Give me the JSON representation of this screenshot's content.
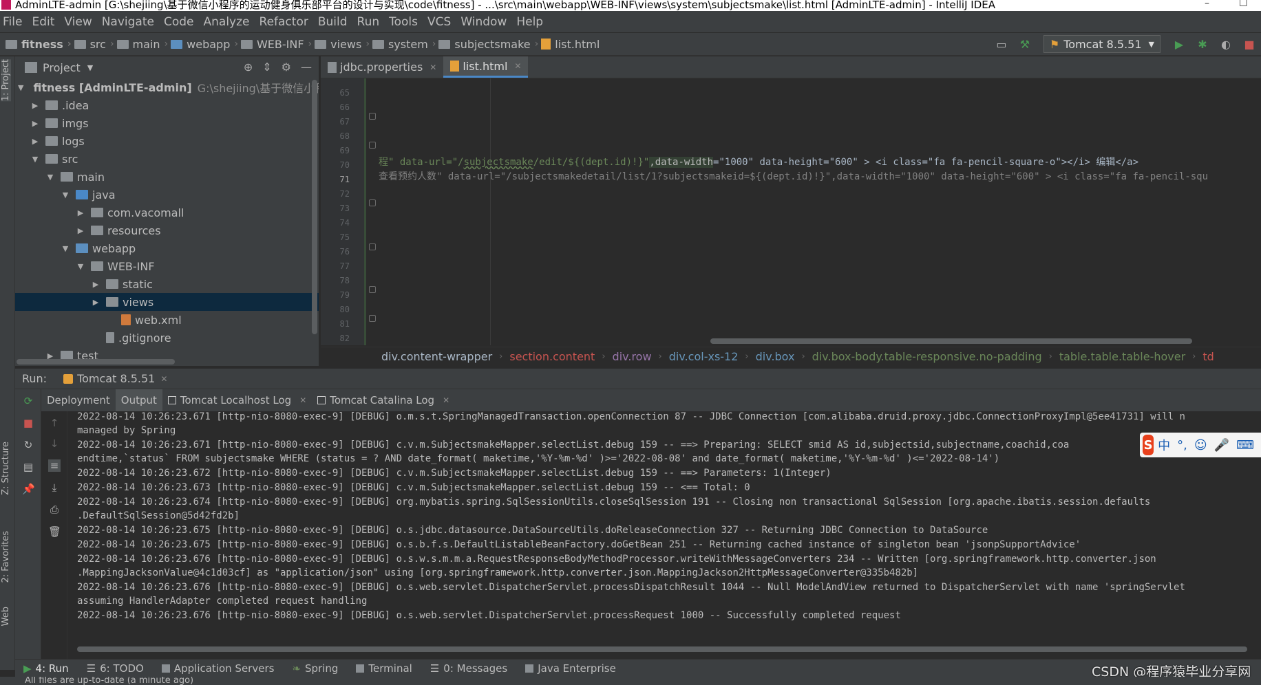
{
  "window": {
    "title": "AdminLTE-admin [G:\\shejiing\\基于微信小程序的运动健身俱乐部平台的设计与实现\\code\\fitness] - ...\\src\\main\\webapp\\WEB-INF\\views\\system\\subjectsmake\\list.html [AdminLTE-admin] - IntelliJ IDEA",
    "minimize": "–",
    "maximize": "☐"
  },
  "menu": [
    "File",
    "Edit",
    "View",
    "Navigate",
    "Code",
    "Analyze",
    "Refactor",
    "Build",
    "Run",
    "Tools",
    "VCS",
    "Window",
    "Help"
  ],
  "nav": {
    "crumbs": [
      "fitness",
      "src",
      "main",
      "webapp",
      "WEB-INF",
      "views",
      "system",
      "subjectsmake"
    ],
    "file": "list.html",
    "run_config": "Tomcat 8.5.51"
  },
  "project": {
    "header": "Project",
    "root_name": "fitness [AdminLTE-admin]",
    "root_path": "G:\\shejiing\\基于微信小程序",
    "items": [
      {
        "label": ".idea",
        "expanded": false
      },
      {
        "label": "imgs",
        "expanded": false
      },
      {
        "label": "logs",
        "expanded": false
      },
      {
        "label": "src",
        "expanded": true
      },
      {
        "label": "main",
        "expanded": true
      },
      {
        "label": "java",
        "expanded": true
      },
      {
        "label": "com.vacomall",
        "expanded": false
      },
      {
        "label": "resources",
        "expanded": false
      },
      {
        "label": "webapp",
        "expanded": true
      },
      {
        "label": "WEB-INF",
        "expanded": true
      },
      {
        "label": "static",
        "expanded": false
      },
      {
        "label": "views",
        "expanded": false
      },
      {
        "label": "web.xml",
        "expanded": null
      },
      {
        "label": ".gitignore",
        "expanded": null
      },
      {
        "label": "test",
        "expanded": false
      }
    ]
  },
  "editor": {
    "tabs": [
      "jdbc.properties",
      "list.html"
    ],
    "line_numbers": [
      "65",
      "66",
      "67",
      "68",
      "69",
      "70",
      "71",
      "72",
      "73",
      "74",
      "75",
      "76",
      "77",
      "78",
      "79",
      "80",
      "81",
      "82"
    ],
    "line70": {
      "p1": "程\" data-url=\"/",
      "p2": "subjectsmake",
      "p3": "/edit/${(dept.id)!}\"",
      "p4": ",data-width",
      "p5": "=\"1000\" data-height=\"600\" > <i class=\"fa fa-pencil-square-o\"></i> 编辑</a>"
    },
    "line71": "查看预约人数\" data-url=\"/subjectsmakedetail/list/1?subjectsmakeid=${(dept.id)!}\",data-width=\"1000\" data-height=\"600\" > <i class=\"fa fa-pencil-squ",
    "breadcrumbs": [
      "div.content-wrapper",
      "section.content",
      "div.row",
      "div.col-xs-12",
      "div.box",
      "div.box-body.table-responsive.no-padding",
      "table.table.table-hover",
      "td"
    ]
  },
  "run": {
    "label": "Run:",
    "config_tab": "Tomcat 8.5.51",
    "subtabs": [
      "Deployment",
      "Output",
      "Tomcat Localhost Log",
      "Tomcat Catalina Log"
    ],
    "console": [
      "2022-08-14 10:26:23.671 [http-nio-8080-exec-9] [DEBUG] o.m.s.t.SpringManagedTransaction.openConnection 87 -- JDBC Connection [com.alibaba.druid.proxy.jdbc.ConnectionProxyImpl@5ee41731] will n",
      " managed by Spring",
      "2022-08-14 10:26:23.671 [http-nio-8080-exec-9] [DEBUG] c.v.m.SubjectsmakeMapper.selectList.debug 159 -- ==>  Preparing: SELECT smid AS id,subjectsid,subjectname,coachid,coa",
      " endtime,`status` FROM subjectsmake WHERE (status = ? AND date_format( maketime,'%Y-%m-%d' )>='2022-08-08' and date_format( maketime,'%Y-%m-%d' )<='2022-08-14')",
      "2022-08-14 10:26:23.672 [http-nio-8080-exec-9] [DEBUG] c.v.m.SubjectsmakeMapper.selectList.debug 159 -- ==> Parameters: 1(Integer)",
      "2022-08-14 10:26:23.673 [http-nio-8080-exec-9] [DEBUG] c.v.m.SubjectsmakeMapper.selectList.debug 159 -- <==      Total: 0",
      "2022-08-14 10:26:23.674 [http-nio-8080-exec-9] [DEBUG] org.mybatis.spring.SqlSessionUtils.closeSqlSession 191 -- Closing non transactional SqlSession [org.apache.ibatis.session.defaults",
      " .DefaultSqlSession@5d42fd2b]",
      "2022-08-14 10:26:23.675 [http-nio-8080-exec-9] [DEBUG] o.s.jdbc.datasource.DataSourceUtils.doReleaseConnection 327 -- Returning JDBC Connection to DataSource",
      "2022-08-14 10:26:23.675 [http-nio-8080-exec-9] [DEBUG] o.s.b.f.s.DefaultListableBeanFactory.doGetBean 251 -- Returning cached instance of singleton bean 'jsonpSupportAdvice'",
      "2022-08-14 10:26:23.676 [http-nio-8080-exec-9] [DEBUG] o.s.w.s.m.m.a.RequestResponseBodyMethodProcessor.writeWithMessageConverters 234 -- Written [org.springframework.http.converter.json",
      " .MappingJacksonValue@4c1d03cf] as \"application/json\" using [org.springframework.http.converter.json.MappingJackson2HttpMessageConverter@335b482b]",
      "2022-08-14 10:26:23.676 [http-nio-8080-exec-9] [DEBUG] o.s.web.servlet.DispatcherServlet.processDispatchResult 1044 -- Null ModelAndView returned to DispatcherServlet with name 'springServlet",
      " assuming HandlerAdapter completed request handling",
      "2022-08-14 10:26:23.676 [http-nio-8080-exec-9] [DEBUG] o.s.web.servlet.DispatcherServlet.processRequest 1000 -- Successfully completed request"
    ]
  },
  "left_strip": [
    "1: Project",
    "Z: Structure",
    "2: Favorites",
    "Web"
  ],
  "bottom_tabs": [
    "4: Run",
    "6: TODO",
    "Application Servers",
    "Spring",
    "Terminal",
    "0: Messages",
    "Java Enterprise"
  ],
  "status": "All files are up-to-date (a minute ago)",
  "watermark": "CSDN @程序猿毕业分享网",
  "ime": {
    "logo": "S",
    "lang": "中",
    "punct": "°,",
    "emoji": "☺",
    "mic": "🎤",
    "kbd": "⌨"
  },
  "colors": {
    "accent": "#4a88c7",
    "run_green": "#499c54",
    "stop_red": "#c75450"
  }
}
